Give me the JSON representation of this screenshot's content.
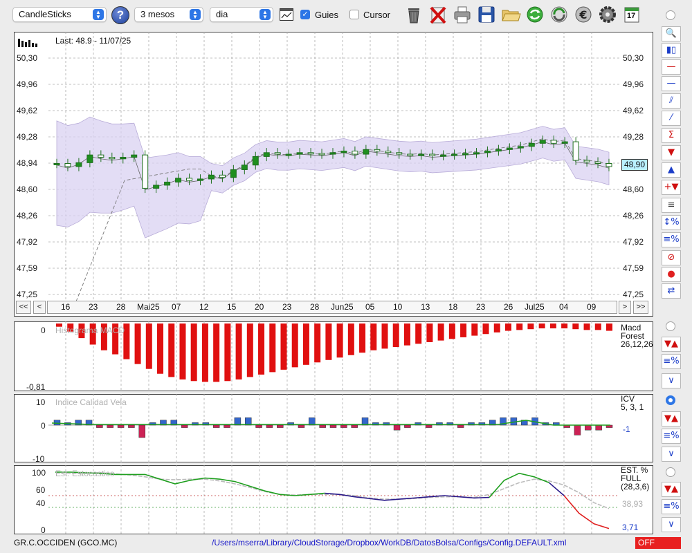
{
  "toolbar": {
    "chart_type": "CandleSticks",
    "period": "3 mesos",
    "interval": "dia",
    "guides_label": "Guies",
    "guides_checked": true,
    "cursor_label": "Cursor",
    "cursor_checked": false,
    "help_label": "?",
    "calendar_day": "17"
  },
  "price_chart": {
    "last_label": "Last: 48.9 - 11/07/25",
    "y_ticks": [
      "50,30",
      "49,96",
      "49,62",
      "49,28",
      "48,94",
      "48,60",
      "48,26",
      "47,92",
      "47,59",
      "47,25"
    ],
    "current_price": "48,90",
    "x_labels": [
      "16",
      "23",
      "28",
      "Mai25",
      "07",
      "12",
      "15",
      "20",
      "23",
      "28",
      "Jun25",
      "05",
      "10",
      "13",
      "18",
      "23",
      "26",
      "Jul25",
      "04",
      "09"
    ],
    "nav_first": "<<",
    "nav_prev": "<",
    "nav_next": ">",
    "nav_last": ">>"
  },
  "chart_data": [
    {
      "type": "candlestick",
      "title": "",
      "ylim": [
        47.25,
        50.3
      ],
      "close": [
        48.94,
        48.9,
        48.95,
        49.05,
        49.02,
        49.0,
        49.02,
        49.05,
        48.62,
        48.66,
        48.7,
        48.75,
        48.72,
        48.74,
        48.79,
        48.76,
        48.86,
        48.92,
        49.03,
        49.08,
        49.06,
        49.06,
        49.08,
        49.07,
        49.06,
        49.08,
        49.1,
        49.06,
        49.12,
        49.1,
        49.08,
        49.06,
        49.05,
        49.06,
        49.04,
        49.05,
        49.06,
        49.07,
        49.08,
        49.1,
        49.12,
        49.14,
        49.16,
        49.2,
        49.24,
        49.2,
        49.22,
        48.98,
        48.96,
        48.94,
        48.9
      ]
    },
    {
      "type": "bar",
      "title": "Histograma MACD",
      "ylim": [
        -0.81,
        0
      ],
      "values": [
        -0.04,
        -0.1,
        -0.18,
        -0.26,
        -0.33,
        -0.38,
        -0.44,
        -0.5,
        -0.56,
        -0.62,
        -0.66,
        -0.69,
        -0.71,
        -0.72,
        -0.72,
        -0.71,
        -0.69,
        -0.66,
        -0.63,
        -0.6,
        -0.57,
        -0.54,
        -0.51,
        -0.48,
        -0.45,
        -0.42,
        -0.39,
        -0.36,
        -0.33,
        -0.31,
        -0.29,
        -0.27,
        -0.25,
        -0.23,
        -0.21,
        -0.19,
        -0.17,
        -0.15,
        -0.13,
        -0.11,
        -0.09,
        -0.08,
        -0.07,
        -0.06,
        -0.06,
        -0.06,
        -0.07,
        -0.08,
        -0.08,
        -0.09
      ]
    },
    {
      "type": "bar",
      "title": "Indice Calidad Vela",
      "ylim": [
        -10,
        10
      ],
      "values": [
        2,
        1,
        2,
        2,
        -1,
        -1,
        -1,
        -1,
        -5,
        1,
        2,
        2,
        -1,
        1,
        1,
        -1,
        -1,
        3,
        3,
        -1,
        -1,
        -1,
        1,
        -1,
        3,
        -1,
        -1,
        -1,
        -1,
        3,
        1,
        1,
        -2,
        -1,
        1,
        -1,
        1,
        1,
        -1,
        1,
        1,
        2,
        3,
        3,
        2,
        3,
        1,
        1,
        -1,
        -4,
        -2,
        -2,
        -1
      ]
    },
    {
      "type": "line",
      "title": "Est. Estocastico",
      "ylim": [
        0,
        100
      ],
      "series": [
        {
          "name": "",
          "values": [
            100,
            100,
            99,
            98,
            96,
            96,
            96,
            88,
            80,
            86,
            90,
            88,
            84,
            76,
            68,
            62,
            60,
            62,
            64,
            62,
            58,
            55,
            52,
            54,
            56,
            58,
            60,
            58,
            56,
            57,
            86,
            98,
            92,
            82,
            60,
            30,
            12,
            4
          ]
        },
        {
          "name": "",
          "values": [
            100,
            98,
            98,
            99,
            97,
            95,
            92,
            88,
            87,
            88,
            88,
            85,
            80,
            74,
            67,
            62,
            61,
            62,
            62,
            62,
            60,
            56,
            54,
            54,
            55,
            57,
            58,
            58,
            57,
            62,
            72,
            82,
            88,
            85,
            78,
            65,
            48,
            38
          ]
        }
      ]
    }
  ],
  "macd_panel": {
    "title": "Histograma MACD",
    "y_top": "0",
    "y_bottom": "-0,81",
    "side_label": "Macd",
    "side_label2": "Forest",
    "side_params": "26,12,26"
  },
  "icv_panel": {
    "title": "Indice Calidad Vela",
    "y_top": "10",
    "y_mid": "0",
    "y_bottom": "-10",
    "side_label": "ICV",
    "side_params": "5, 3, 1",
    "side_value": "-1"
  },
  "stoch_panel": {
    "title": "Est. Estocastico",
    "y_100": "100",
    "y_60": "60",
    "y_40": "40",
    "y_0": "0",
    "side_label": "EST. %",
    "side_label2": "FULL",
    "side_params": "(28,3,6)",
    "value_grey": "38,93",
    "value_blue": "3,71"
  },
  "status_bar": {
    "symbol": "GR.C.OCCIDEN (GCO.MC)",
    "config_path": "/Users/mserra/Library/CloudStorage/Dropbox/WorkDB/DatosBolsa/Configs/Config.DEFAULT.xml",
    "status": "OFF"
  },
  "colors": {
    "up_candle": "#1f8f1f",
    "down_candle": "#ffffff",
    "band_fill": "#d9d2f2",
    "macd_bar": "#e01010",
    "icv_pos": "#3366cc",
    "icv_neg": "#cc2255",
    "status_off": "#e02020",
    "accent": "#2d76e6"
  }
}
